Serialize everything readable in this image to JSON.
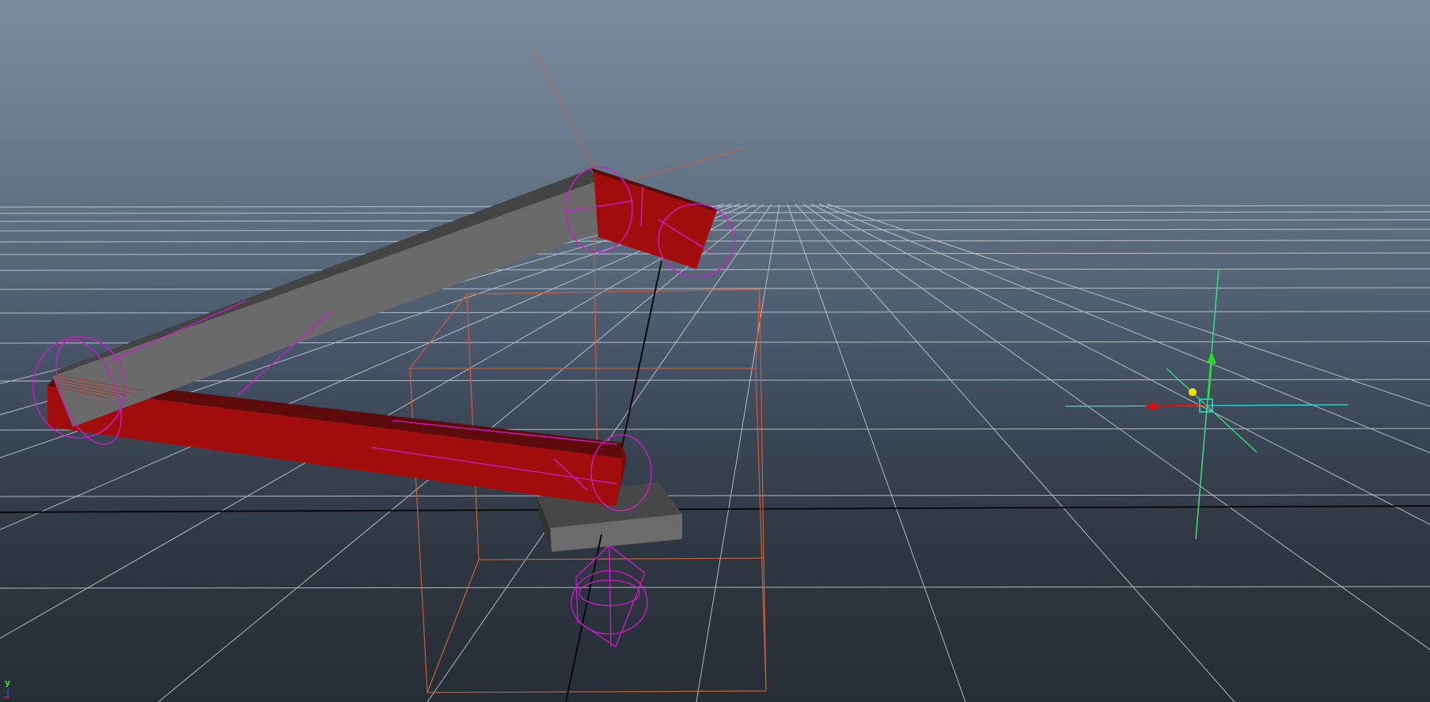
{
  "viewport": {
    "axis_indicator": {
      "y_label": "y"
    }
  },
  "colors": {
    "grid": "#c9ced6",
    "ground_line": "#0a0a0a",
    "arm_red": "#a10d0d",
    "arm_red_dark": "#5c0a0a",
    "arm_gray": "#6a6a6a",
    "arm_gray_dark": "#444444",
    "wire_magenta": "#d11ad1",
    "bbox_orange": "#c8603a",
    "manip_green": "#35e07a",
    "manip_cyan": "#3ad8c8",
    "manip_red": "#d61010",
    "manip_yellow": "#f0e000",
    "axis_y_green": "#22dd22",
    "axis_z_blue": "#2255ff",
    "axis_x_red": "#dd2222"
  },
  "icons": {
    "move_manipulator": "transform-manipulator-icon",
    "axis_indicator": "view-axis-icon"
  }
}
